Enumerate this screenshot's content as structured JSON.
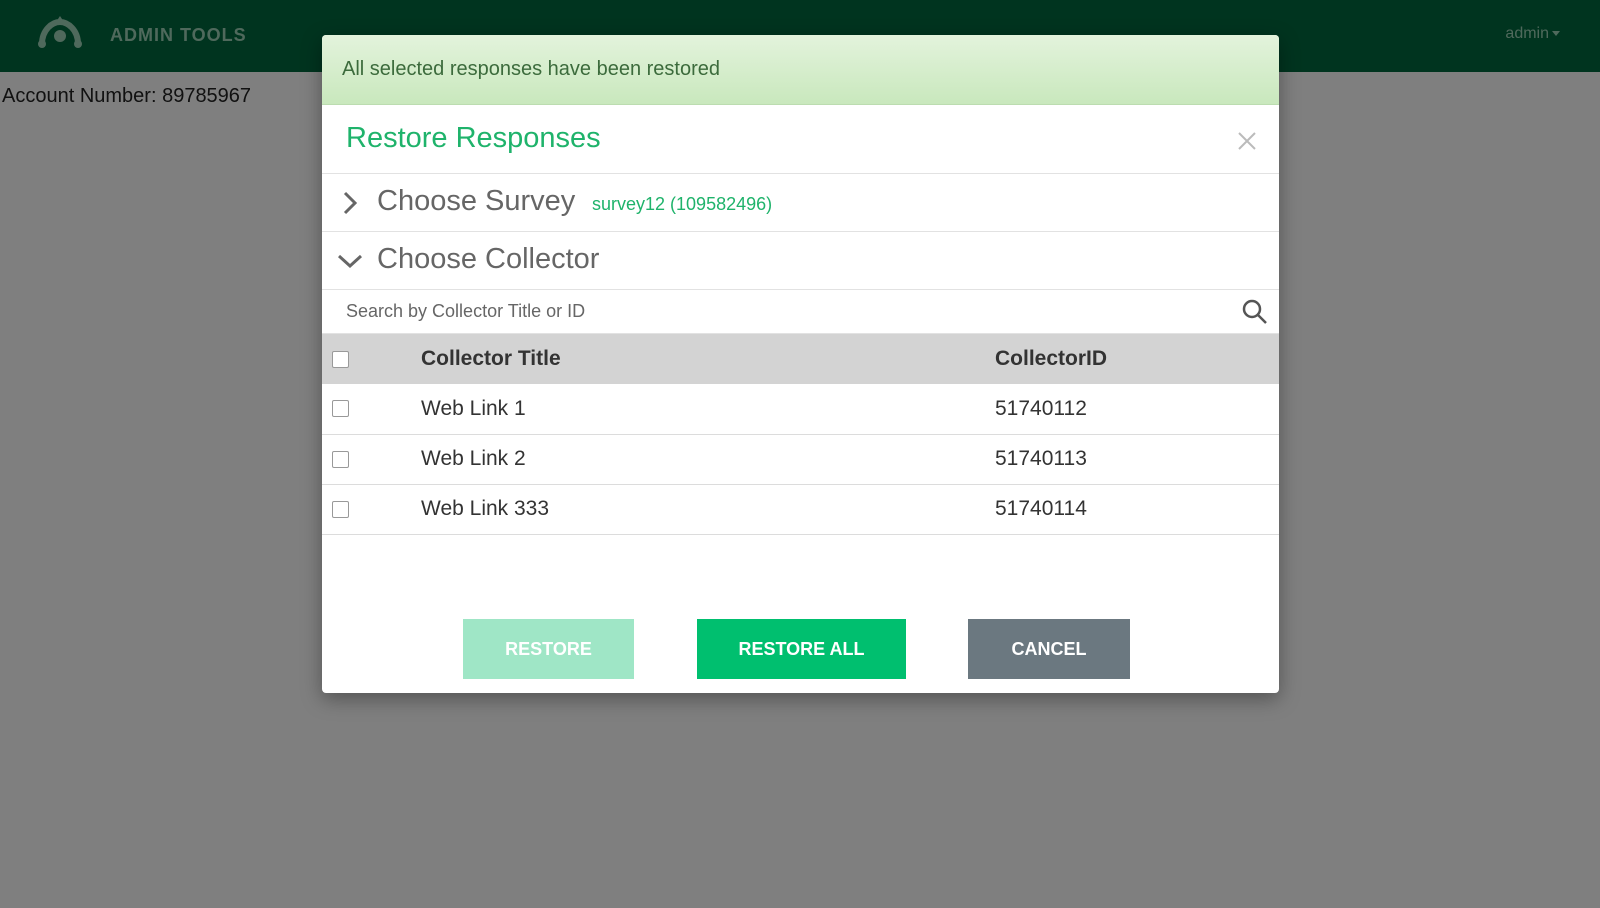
{
  "app": {
    "brand": "ADMIN TOOLS",
    "user_menu": "admin"
  },
  "page": {
    "account_label": "Account Number: 89785967"
  },
  "alert": {
    "message": "All selected responses have been restored"
  },
  "modal": {
    "title": "Restore Responses",
    "sections": [
      {
        "label": "Choose Survey",
        "value": "survey12 (109582496)",
        "expanded": false
      },
      {
        "label": "Choose Collector",
        "expanded": true
      }
    ],
    "search": {
      "placeholder": "Search by Collector Title or ID",
      "value": ""
    },
    "table": {
      "columns": [
        "Collector Title",
        "CollectorID"
      ],
      "rows": [
        {
          "title": "Web Link 1",
          "id": "51740112",
          "checked": false
        },
        {
          "title": "Web Link 2",
          "id": "51740113",
          "checked": false
        },
        {
          "title": "Web Link 333",
          "id": "51740114",
          "checked": false
        }
      ]
    },
    "buttons": {
      "restore": "RESTORE",
      "restore_all": "RESTORE ALL",
      "cancel": "CANCEL"
    }
  },
  "colors": {
    "topbar": "#00693e",
    "accent": "#00bf6f",
    "title_green": "#1fb36b",
    "restore_disabled": "#9fe6c6",
    "cancel": "#6b7880"
  },
  "icons": [
    "monkey-logo-icon",
    "close-icon",
    "chevron-right-icon",
    "chevron-down-icon",
    "search-icon",
    "caret-down-icon"
  ]
}
